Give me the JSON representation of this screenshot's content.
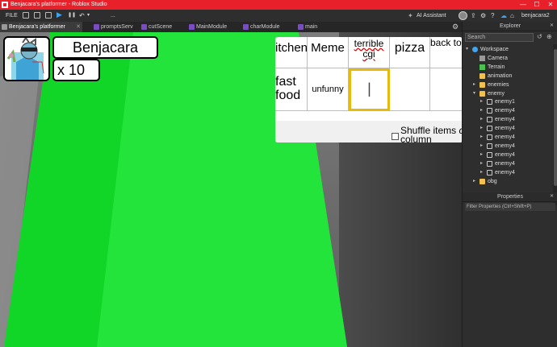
{
  "titlebar": {
    "title": "Benjacara's platformer - Roblox Studio",
    "minimize": "—",
    "maximize": "☐",
    "close": "✕"
  },
  "toolbar": {
    "file": "FILE",
    "more": "...",
    "ai_assistant": "AI Assistant",
    "username": "benjacara2"
  },
  "tabs": [
    {
      "label": "Benjacara's platformer",
      "active": true
    },
    {
      "label": "promptsServ"
    },
    {
      "label": "cutScene"
    },
    {
      "label": "MainModule"
    },
    {
      "label": "charModule"
    },
    {
      "label": "main"
    }
  ],
  "game": {
    "player_name": "Benjacara",
    "lives": "x 10"
  },
  "tier_list": {
    "headers": [
      "itchen",
      "Meme",
      "terrible cgi",
      "pizza",
      "back to school"
    ],
    "row_items": [
      "fast food",
      "unfunny",
      "|",
      "",
      ""
    ],
    "shuffle_label": "Shuffle items",
    "shuffle_label_italic": "one",
    "shuffle_label_end": "column"
  },
  "explorer": {
    "title": "Explorer",
    "search_placeholder": "Search",
    "items": [
      {
        "label": "Workspace",
        "icon": "workspace-icon",
        "depth": 0,
        "expanded": true
      },
      {
        "label": "Camera",
        "icon": "camera-icon",
        "depth": 1
      },
      {
        "label": "Terrain",
        "icon": "terrain-icon",
        "depth": 1
      },
      {
        "label": "animation",
        "icon": "folder-icon",
        "depth": 1
      },
      {
        "label": "enemies",
        "icon": "folder-icon",
        "depth": 1,
        "collapsed": true
      },
      {
        "label": "enemy",
        "icon": "folder-icon",
        "depth": 1,
        "expanded": true
      },
      {
        "label": "enemy1",
        "icon": "model-icon",
        "depth": 2
      },
      {
        "label": "enemy4",
        "icon": "model-icon",
        "depth": 2
      },
      {
        "label": "enemy4",
        "icon": "model-icon",
        "depth": 2
      },
      {
        "label": "enemy4",
        "icon": "model-icon",
        "depth": 2
      },
      {
        "label": "enemy4",
        "icon": "model-icon",
        "depth": 2
      },
      {
        "label": "enemy4",
        "icon": "model-icon",
        "depth": 2
      },
      {
        "label": "enemy4",
        "icon": "model-icon",
        "depth": 2
      },
      {
        "label": "enemy4",
        "icon": "model-icon",
        "depth": 2
      },
      {
        "label": "enemy4",
        "icon": "model-icon",
        "depth": 2
      },
      {
        "label": "obg",
        "icon": "folder-icon",
        "depth": 1,
        "collapsed": true
      }
    ]
  },
  "properties": {
    "title": "Properties",
    "filter_placeholder": "Filter Properties (Ctrl+Shift+P)"
  },
  "colors": {
    "titlebar": "#e8202a",
    "green_floor": "#11d627",
    "highlight_cell": "#e8b90c"
  }
}
